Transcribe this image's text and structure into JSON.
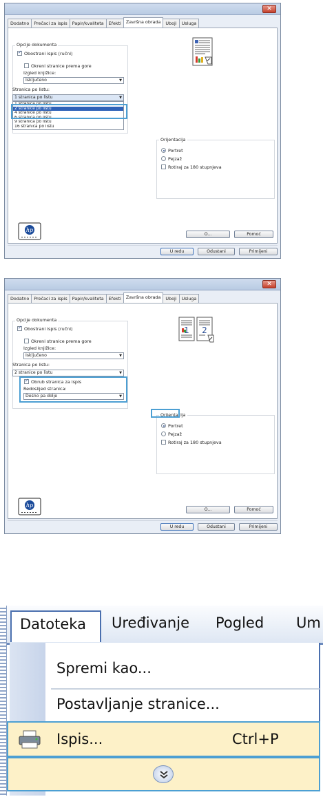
{
  "dialogs": [
    {
      "tabs": [
        "Dodatno",
        "Prečaci za ispis",
        "Papir/kvaliteta",
        "Efekti",
        "Završna obrada",
        "Uboji",
        "Usluga"
      ],
      "active_tab": "Završna obrada",
      "doc_options": {
        "group_label": "Opcije dokumenta",
        "duplex_label": "Obostrani ispis (ručni)",
        "duplex_checked": true,
        "flip_label": "Okreni stranice prema gore",
        "flip_checked": false,
        "booklet_label": "Izgled knjižice:",
        "booklet_value": "Isključeno",
        "pages_per_sheet_label": "Stranica po listu:",
        "pages_per_sheet_value": "1 stranica po listu"
      },
      "pages_list": [
        "1 stranica po listu",
        "2 stranice po listu",
        "4 stranice po listu",
        "6 stranica po listu",
        "9 stranica po listu",
        "16 stranica po listu"
      ],
      "pages_list_selected": "2 stranice po listu",
      "orientation": {
        "group_label": "Orijentacija",
        "portrait": "Portret",
        "landscape": "Pejzaž",
        "rotate": "Rotiraj za 180 stupnjeva",
        "selected": "Portret"
      },
      "buttons": {
        "about": "O...",
        "help": "Pomoć",
        "ok": "U redu",
        "cancel": "Odustani",
        "apply": "Primijeni"
      }
    },
    {
      "tabs": [
        "Dodatno",
        "Prečaci za ispis",
        "Papir/kvaliteta",
        "Efekti",
        "Završna obrada",
        "Uboji",
        "Usluga"
      ],
      "active_tab": "Završna obrada",
      "doc_options": {
        "group_label": "Opcije dokumenta",
        "duplex_label": "Obostrani ispis (ručni)",
        "duplex_checked": true,
        "flip_label": "Okreni stranice prema gore",
        "flip_checked": false,
        "booklet_label": "Izgled knjižice:",
        "booklet_value": "Isključeno",
        "pages_per_sheet_label": "Stranica po listu:",
        "pages_per_sheet_value": "2 stranice po listu",
        "border_label": "Obrub stranica za ispis",
        "border_checked": true,
        "order_label": "Redoslijed stranica:",
        "order_value": "Desno pa dolje"
      },
      "orientation": {
        "group_label": "Orijentacija",
        "portrait": "Portret",
        "landscape": "Pejzaž",
        "rotate": "Rotiraj za 180 stupnjeva",
        "selected": "Portret"
      },
      "buttons": {
        "about": "O...",
        "help": "Pomoć",
        "ok": "U redu",
        "cancel": "Odustani",
        "apply": "Primijeni"
      }
    }
  ],
  "menu": {
    "bar": [
      "Datoteka",
      "Uređivanje",
      "Pogled",
      "Um"
    ],
    "open_menu": "Datoteka",
    "items": [
      {
        "label": "Spremi kao...",
        "shortcut": ""
      },
      {
        "label": "Postavljanje stranice...",
        "shortcut": ""
      },
      {
        "label": "Ispis...",
        "shortcut": "Ctrl+P"
      }
    ],
    "expand_icon": "chevron-double-down-icon"
  },
  "colors": {
    "callout": "#4c9fd3",
    "selection": "#2f62b8",
    "highlight_row": "#fdf1c8"
  }
}
